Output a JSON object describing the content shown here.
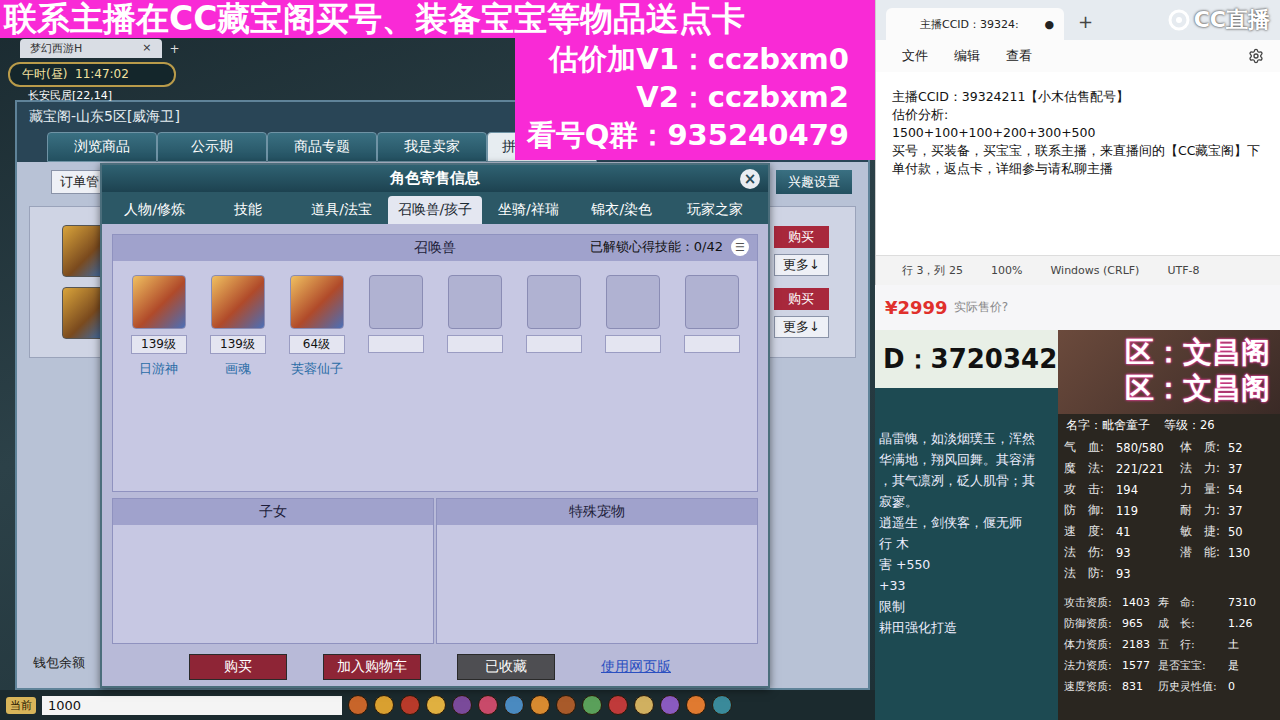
{
  "banner": {
    "headline": "联系主播在CC藏宝阁买号、装备宝宝等物品送点卡",
    "contact_lines": [
      "估价加V1：cczbxm0",
      "V2：cczbxm2",
      "看号Q群：935240479"
    ]
  },
  "game": {
    "browser_tab": {
      "label": "梦幻西游H",
      "close": "×",
      "add": "+"
    },
    "clock": {
      "time": "午时(昼)  11:47:02",
      "location": "长安民居[22,14]"
    },
    "window_title": "藏宝阁-山东5区[威海卫]",
    "tabs": [
      {
        "label": "浏览商品",
        "selected": false
      },
      {
        "label": "公示期",
        "selected": false
      },
      {
        "label": "商品专题",
        "selected": false
      },
      {
        "label": "我是卖家",
        "selected": false
      },
      {
        "label": "拼",
        "selected": true
      }
    ],
    "order_field": "订单管",
    "interest_button": "兴趣设置",
    "rows": [
      {
        "buy": "购买",
        "more": "更多↓"
      },
      {
        "buy": "购买",
        "more": "更多↓"
      }
    ],
    "wallet": "钱包余额",
    "chat": {
      "channel": "当前",
      "input": "1000"
    }
  },
  "dialog": {
    "title": "角色寄售信息",
    "close": "×",
    "tabs": [
      {
        "label": "人物/修炼",
        "selected": false
      },
      {
        "label": "技能",
        "selected": false
      },
      {
        "label": "道具/法宝",
        "selected": false
      },
      {
        "label": "召唤兽/孩子",
        "selected": true
      },
      {
        "label": "坐骑/祥瑞",
        "selected": false
      },
      {
        "label": "锦衣/染色",
        "selected": false
      },
      {
        "label": "玩家之家",
        "selected": false
      }
    ],
    "pet_section": {
      "title": "召唤兽",
      "skills": "已解锁心得技能：0/42",
      "menu": "☰"
    },
    "slots": [
      {
        "filled": true,
        "level": "139级",
        "name": "日游神"
      },
      {
        "filled": true,
        "level": "139级",
        "name": "画魂"
      },
      {
        "filled": true,
        "level": "64级",
        "name": "芙蓉仙子"
      },
      {
        "filled": false
      },
      {
        "filled": false
      },
      {
        "filled": false
      },
      {
        "filled": false
      },
      {
        "filled": false
      }
    ],
    "panels": [
      "子女",
      "特殊宠物"
    ],
    "buttons": [
      {
        "label": "购买",
        "kind": "primary"
      },
      {
        "label": "加入购物车",
        "kind": "primary"
      },
      {
        "label": "已收藏",
        "kind": "muted"
      },
      {
        "label": "使用网页版",
        "kind": "link"
      }
    ]
  },
  "notepad": {
    "tab": "主播CCID：39324:",
    "dirty": "●",
    "add": "+",
    "logo": "CC直播",
    "menu": [
      "文件",
      "编辑",
      "查看"
    ],
    "lines": [
      "主播CCID：39324211【小木估售配号】",
      "估价分析:",
      "1500+100+100+200+300+500",
      "买号，买装备，买宝宝，联系主播，来直播间的【CC藏宝阁】下单付款，返点卡，详细参与请私聊主播"
    ],
    "status": [
      "行 3，列 25",
      "100%",
      "Windows (CRLF)",
      "UTF-8"
    ]
  },
  "price_strip": {
    "price": "¥2999",
    "note": "实际售价?"
  },
  "pet_panel": {
    "id": "D：3720342",
    "servers": [
      "区：文昌阁",
      "区：文昌阁"
    ],
    "description": [
      "晶雷魄，如淡烟璞玉，浑然",
      "华满地，翔风回舞。其容清",
      "，其气凛冽，砭人肌骨；其",
      "寂寥。",
      "逍遥生，剑侠客，偃无师",
      "行 木",
      "害 +550",
      "+33",
      "限制",
      "耕田强化打造"
    ],
    "name": "名字：毗舍童子",
    "level": "等级：26",
    "basic": [
      [
        {
          "label": "气　血:",
          "value": "580/580"
        },
        {
          "label": "体　质:",
          "value": "52"
        }
      ],
      [
        {
          "label": "魔　法:",
          "value": "221/221"
        },
        {
          "label": "法　力:",
          "value": "37"
        }
      ],
      [
        {
          "label": "攻　击:",
          "value": "194"
        },
        {
          "label": "力　量:",
          "value": "54"
        }
      ],
      [
        {
          "label": "防　御:",
          "value": "119"
        },
        {
          "label": "耐　力:",
          "value": "37"
        }
      ],
      [
        {
          "label": "速　度:",
          "value": "41"
        },
        {
          "label": "敏　捷:",
          "value": "50"
        }
      ],
      [
        {
          "label": "法　伤:",
          "value": "93"
        },
        {
          "label": "潜　能:",
          "value": "130"
        }
      ],
      [
        {
          "label": "法　防:",
          "value": "93"
        }
      ]
    ],
    "aptitude": [
      [
        {
          "label": "攻击资质:",
          "value": "1403"
        },
        {
          "label": "寿　命:",
          "value": "7310"
        }
      ],
      [
        {
          "label": "防御资质:",
          "value": "965"
        },
        {
          "label": "成　长:",
          "value": "1.26"
        }
      ],
      [
        {
          "label": "体力资质:",
          "value": "2183"
        },
        {
          "label": "五　行:",
          "value": "土"
        }
      ],
      [
        {
          "label": "法力资质:",
          "value": "1577"
        },
        {
          "label": "是否宝宝:",
          "value": "是"
        }
      ],
      [
        {
          "label": "速度资质:",
          "value": "831"
        },
        {
          "label": "历史灵性值:",
          "value": "0"
        }
      ]
    ]
  }
}
